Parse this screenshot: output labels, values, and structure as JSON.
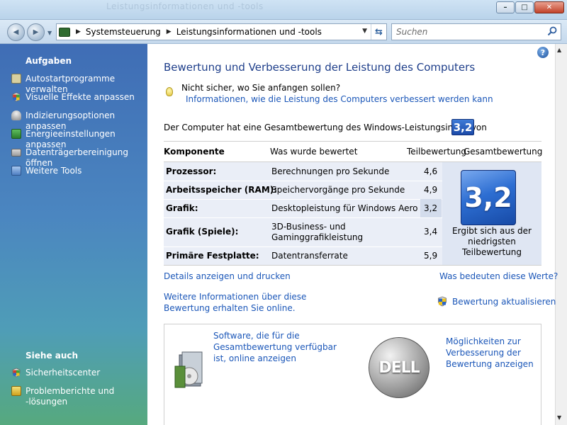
{
  "window": {
    "ghost_title": "Leistungsinformationen und -tools",
    "minimize": "–",
    "maximize": "□",
    "close": "✕"
  },
  "nav": {
    "back_glyph": "◀",
    "forward_glyph": "▶",
    "path": [
      "Systemsteuerung",
      "Leistungsinformationen und -tools"
    ],
    "search_placeholder": "Suchen"
  },
  "sidebar": {
    "tasks_heading": "Aufgaben",
    "tasks": [
      {
        "label": "Autostartprogramme verwalten",
        "icon": "startup-icon"
      },
      {
        "label": "Visuelle Effekte anpassen",
        "icon": "shield-icon"
      },
      {
        "label": "Indizierungsoptionen anpassen",
        "icon": "indexing-icon"
      },
      {
        "label": "Energieeinstellungen anpassen",
        "icon": "power-icon"
      },
      {
        "label": "Datenträgerbereinigung öffnen",
        "icon": "disk-cleanup-icon"
      },
      {
        "label": "Weitere Tools",
        "icon": "tools-icon"
      }
    ],
    "see_also_heading": "Siehe auch",
    "see_also": [
      {
        "label": "Sicherheitscenter",
        "icon": "security-center-icon"
      },
      {
        "label": "Problemberichte und -lösungen",
        "icon": "problem-reports-icon"
      }
    ]
  },
  "main": {
    "heading": "Bewertung und Verbesserung der Leistung des Computers",
    "hint_question": "Nicht sicher, wo Sie anfangen sollen?",
    "hint_link": "Informationen, wie die Leistung des Computers verbessert werden kann",
    "score_sentence": "Der Computer hat eine Gesamtbewertung des Windows-Leistungsindex von",
    "total_score": "3,2",
    "table": {
      "headers": [
        "Komponente",
        "Was wurde bewertet",
        "Teilbewertung",
        "Gesamtbewertung"
      ],
      "rows": [
        {
          "component": "Prozessor:",
          "rated": "Berechnungen pro Sekunde",
          "score": "4,6"
        },
        {
          "component": "Arbeitsspeicher (RAM):",
          "rated": "Speichervorgänge pro Sekunde",
          "score": "4,9"
        },
        {
          "component": "Grafik:",
          "rated": "Desktopleistung für Windows Aero",
          "score": "3,2"
        },
        {
          "component": "Grafik (Spiele):",
          "rated": "3D-Business- und Gaminggrafikleistung",
          "score": "3,4"
        },
        {
          "component": "Primäre Festplatte:",
          "rated": "Datentransferrate",
          "score": "5,9"
        }
      ],
      "total_caption": "Ergibt sich aus der niedrigsten Teilbewertung"
    },
    "links": {
      "details": "Details anzeigen und drucken",
      "meaning": "Was bedeuten diese Werte?",
      "more_info": "Weitere Informationen über diese Bewertung erhalten Sie online.",
      "refresh": "Bewertung aktualisieren",
      "software": "Software, die für die Gesamtbewertung verfügbar ist, online anzeigen",
      "improve": "Möglichkeiten zur Verbesserung der Bewertung anzeigen"
    },
    "oem_logo": "DELL"
  },
  "colors": {
    "link": "#1a56b8",
    "heading": "#1e3e8a",
    "score_tile": "#2d6ed2",
    "sidebar_top": "#3f6db5",
    "sidebar_bottom": "#56a97e"
  }
}
